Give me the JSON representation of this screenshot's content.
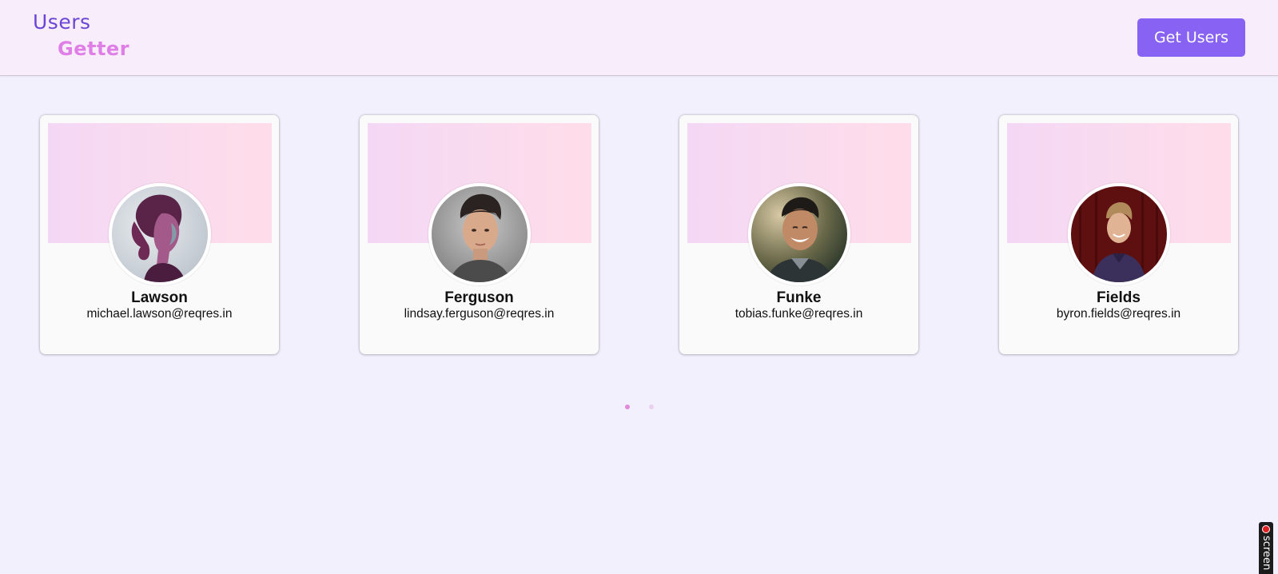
{
  "header": {
    "logo_line1": "Users",
    "logo_line2": "Getter",
    "get_users_label": "Get Users"
  },
  "users": [
    {
      "last_name": "Lawson",
      "email": "michael.lawson@reqres.in"
    },
    {
      "last_name": "Ferguson",
      "email": "lindsay.ferguson@reqres.in"
    },
    {
      "last_name": "Funke",
      "email": "tobias.funke@reqres.in"
    },
    {
      "last_name": "Fields",
      "email": "byron.fields@reqres.in"
    }
  ],
  "pagination": {
    "page_count": 2,
    "active_page": 1
  },
  "recorder_tab": {
    "label": "screen"
  },
  "colors": {
    "brand_purple": "#8862f2",
    "logo_users": "#6a45d6",
    "logo_getter": "#df7ee6",
    "page_bg": "#f3f0fe",
    "header_bg": "#f8edfb"
  }
}
